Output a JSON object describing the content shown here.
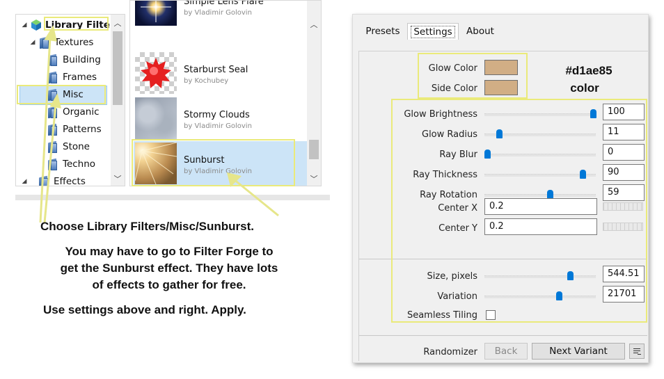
{
  "tree": {
    "items": [
      {
        "label": "Library Filters",
        "expanded": true
      },
      {
        "label": "Textures",
        "expanded": true
      },
      {
        "label": "Building"
      },
      {
        "label": "Frames"
      },
      {
        "label": "Misc",
        "selected": true
      },
      {
        "label": "Organic"
      },
      {
        "label": "Patterns"
      },
      {
        "label": "Stone"
      },
      {
        "label": "Techno"
      },
      {
        "label": "Effects"
      }
    ]
  },
  "filters": {
    "items": [
      {
        "name": "Simple Lens Flare",
        "author": "by Vladimir Golovin"
      },
      {
        "name": "Starburst Seal",
        "author": "by Kochubey"
      },
      {
        "name": "Stormy Clouds",
        "author": "by Vladimir Golovin"
      },
      {
        "name": "Sunburst",
        "author": "by Vladimir Golovin",
        "selected": true
      }
    ]
  },
  "annotations": {
    "left_line1": "Choose Library Filters/Misc/Sunburst.",
    "left_para": [
      "You may have to go to Filter Forge to",
      "get the Sunburst effect.  They have lots",
      "of effects to gather for free."
    ],
    "left_line3": "Use settings above and right.  Apply.",
    "color_hex": "#d1ae85",
    "color_word": "color"
  },
  "settings": {
    "tabs": [
      {
        "label": "Presets"
      },
      {
        "label": "Settings",
        "active": true
      },
      {
        "label": "About"
      }
    ],
    "glow_color_label": "Glow Color",
    "side_color_label": "Side Color",
    "glow_color": "#d1ae85",
    "side_color": "#d1ae85",
    "sliders": [
      {
        "label": "Glow Brightness",
        "value": "100",
        "level": 1.0
      },
      {
        "label": "Glow Radius",
        "value": "11",
        "level": 0.11
      },
      {
        "label": "Ray Blur",
        "value": "0",
        "level": 0.0
      },
      {
        "label": "Ray Thickness",
        "value": "90",
        "level": 0.9
      },
      {
        "label": "Ray Rotation",
        "value": "59",
        "level": 0.59
      }
    ],
    "center_x_label": "Center X",
    "center_x": "0.2",
    "center_y_label": "Center Y",
    "center_y": "0.2",
    "size_label": "Size, pixels",
    "size_value": "544.51",
    "size_level": 0.78,
    "variation_label": "Variation",
    "variation_value": "21701",
    "variation_level": 0.68,
    "seamless_label": "Seamless Tiling",
    "seamless_checked": false,
    "randomizer_label": "Randomizer",
    "back_label": "Back",
    "next_label": "Next Variant"
  }
}
